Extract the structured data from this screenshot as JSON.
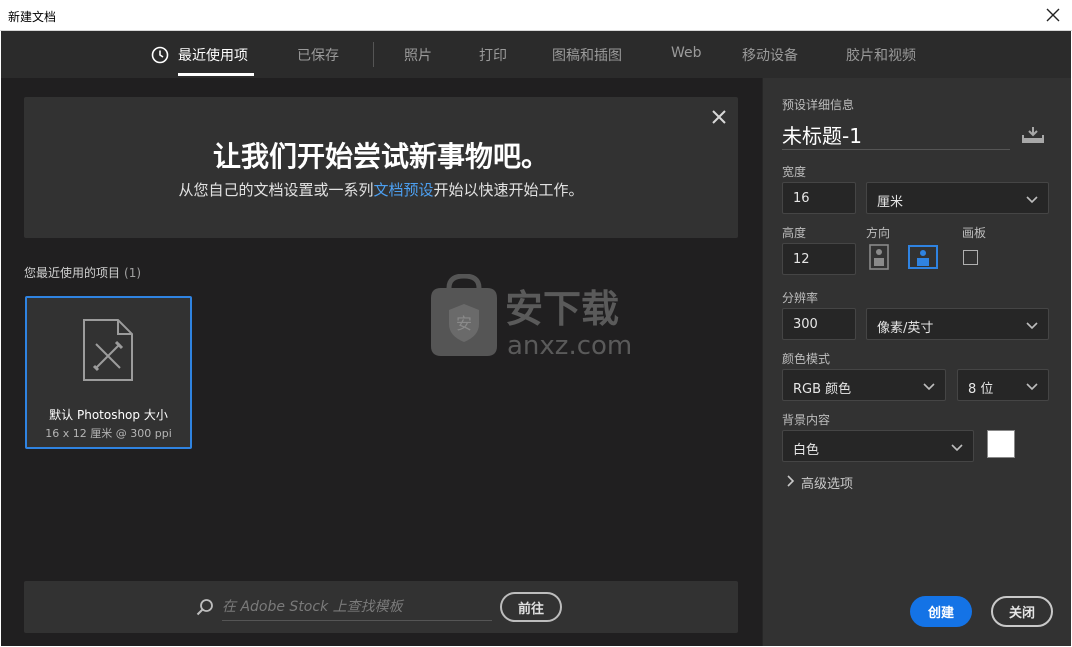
{
  "window": {
    "title": "新建文档"
  },
  "tabs": [
    {
      "label": "最近使用项"
    },
    {
      "label": "已保存"
    },
    {
      "label": "照片"
    },
    {
      "label": "打印"
    },
    {
      "label": "图稿和插图"
    },
    {
      "label": "Web"
    },
    {
      "label": "移动设备"
    },
    {
      "label": "胶片和视频"
    }
  ],
  "banner": {
    "headline": "让我们开始尝试新事物吧。",
    "sub_before": "从您自己的文档设置或一系列",
    "sub_link": "文档预设",
    "sub_after": "开始以快速开始工作。"
  },
  "recent": {
    "title": "您最近使用的项目",
    "count": "(1)",
    "items": [
      {
        "name": "默认 Photoshop 大小",
        "size": "16 x 12 厘米 @ 300 ppi"
      }
    ]
  },
  "watermark": {
    "text": "安下载",
    "domain": "anxz.com"
  },
  "search": {
    "placeholder": "在 Adobe Stock 上查找模板",
    "go_label": "前往"
  },
  "preset": {
    "section_title": "预设详细信息",
    "doc_name": "未标题-1",
    "width_label": "宽度",
    "width_value": "16",
    "width_unit": "厘米",
    "height_label": "高度",
    "height_value": "12",
    "orientation_label": "方向",
    "artboard_label": "画板",
    "resolution_label": "分辨率",
    "resolution_value": "300",
    "resolution_unit": "像素/英寸",
    "color_mode_label": "颜色模式",
    "color_mode_value": "RGB 颜色",
    "bit_depth_value": "8 位",
    "bg_label": "背景内容",
    "bg_value": "白色",
    "bg_swatch": "#ffffff",
    "advanced_label": "高级选项"
  },
  "actions": {
    "create_label": "创建",
    "close_label": "关闭"
  },
  "colors": {
    "accent": "#1473e6",
    "panel": "#323232",
    "canvas": "#201f20",
    "link": "#4c9ff0"
  }
}
